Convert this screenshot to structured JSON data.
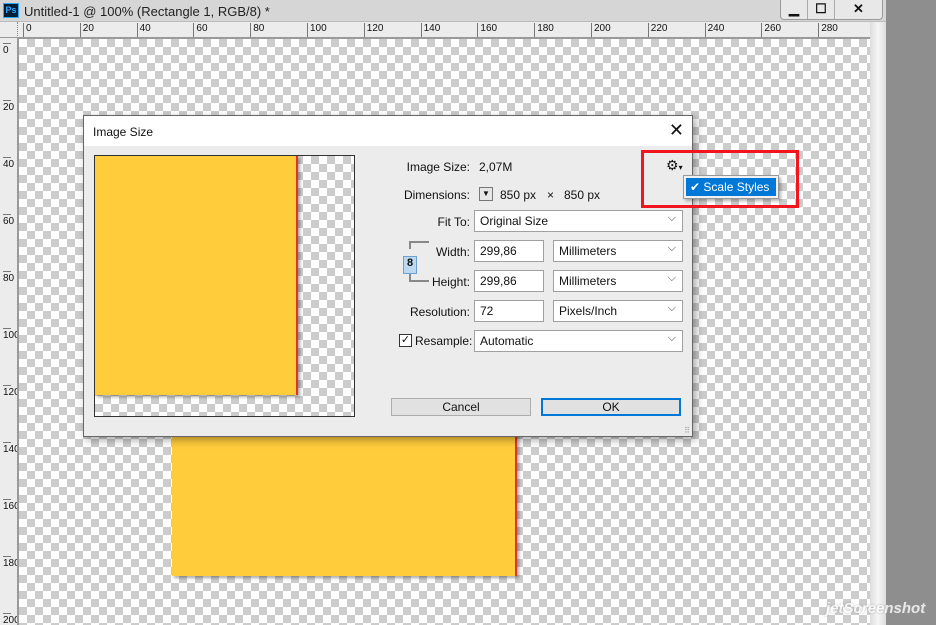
{
  "window": {
    "title": "Untitled-1 @ 100% (Rectangle 1, RGB/8) *",
    "app_logo": "Ps",
    "minimize": "▁",
    "maximize": "☐",
    "close": "✕"
  },
  "rulers": {
    "top": [
      "0",
      "20",
      "40",
      "60",
      "80",
      "100",
      "120",
      "140",
      "160",
      "180",
      "200",
      "220",
      "240",
      "260",
      "280"
    ],
    "left": [
      "0",
      "20",
      "40",
      "60",
      "80",
      "100",
      "120",
      "140",
      "160",
      "180",
      "200"
    ]
  },
  "dialog": {
    "title": "Image Size",
    "close": "✕",
    "image_size_label": "Image Size:",
    "image_size_value": "2,07M",
    "dimensions_label": "Dimensions:",
    "dim_w": "850 px",
    "dim_x": "×",
    "dim_h": "850 px",
    "fit_to_label": "Fit To:",
    "fit_to_value": "Original Size",
    "width_label": "Width:",
    "width_value": "299,86",
    "width_unit": "Millimeters",
    "height_label": "Height:",
    "height_value": "299,86",
    "height_unit": "Millimeters",
    "resolution_label": "Resolution:",
    "resolution_value": "72",
    "resolution_unit": "Pixels/Inch",
    "resample_label": "Resample:",
    "resample_checked": true,
    "resample_value": "Automatic",
    "cancel": "Cancel",
    "ok": "OK",
    "gear_menu": {
      "item": "Scale Styles",
      "checked": true
    }
  },
  "colors": {
    "rect": "#ffcc3b",
    "highlight": "#f2141f",
    "accent": "#0078d7"
  },
  "watermark": "JetScreenshot"
}
